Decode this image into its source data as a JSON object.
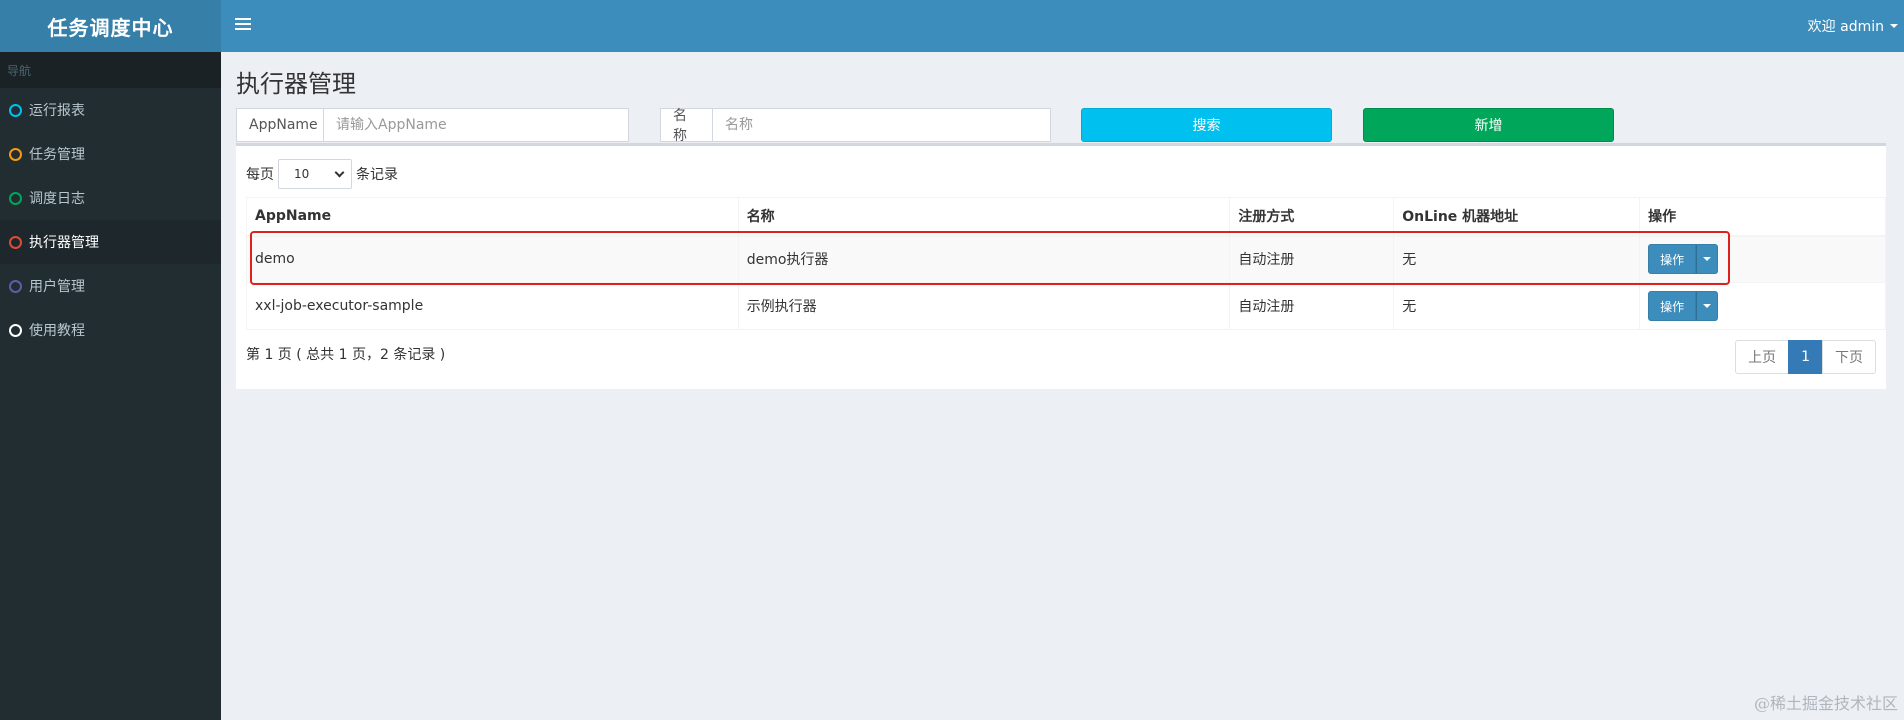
{
  "sidebar": {
    "logo": "任务调度中心",
    "nav_header": "导航",
    "items": [
      {
        "label": "运行报表",
        "color": "#00c0ef",
        "active": false
      },
      {
        "label": "任务管理",
        "color": "#f39c12",
        "active": false
      },
      {
        "label": "调度日志",
        "color": "#00a65a",
        "active": false
      },
      {
        "label": "执行器管理",
        "color": "#dd4b39",
        "active": true
      },
      {
        "label": "用户管理",
        "color": "#605ca8",
        "active": false
      },
      {
        "label": "使用教程",
        "color": "#ffffff",
        "active": false
      }
    ]
  },
  "header": {
    "toggle_icon": "menu-icon",
    "user_label": "欢迎 admin"
  },
  "page": {
    "title": "执行器管理"
  },
  "filters": {
    "appname_label": "AppName",
    "appname_placeholder": "请输入AppName",
    "name_label": "名称",
    "name_placeholder": "名称",
    "search_button": "搜索",
    "add_button": "新增"
  },
  "table_controls": {
    "per_page_prefix": "每页",
    "per_page_value": "10",
    "per_page_suffix": "条记录"
  },
  "table": {
    "columns": [
      "AppName",
      "名称",
      "注册方式",
      "OnLine 机器地址",
      "操作"
    ],
    "rows": [
      {
        "appname": "demo",
        "name": "demo执行器",
        "reg_type": "自动注册",
        "online": "无",
        "action": "操作"
      },
      {
        "appname": "xxl-job-executor-sample",
        "name": "示例执行器",
        "reg_type": "自动注册",
        "online": "无",
        "action": "操作"
      }
    ]
  },
  "pagination": {
    "info": "第 1 页 ( 总共 1 页，2 条记录 )",
    "prev": "上页",
    "current": "1",
    "next": "下页"
  },
  "highlight_color": "#e0201c",
  "watermark": "@稀土掘金技术社区"
}
